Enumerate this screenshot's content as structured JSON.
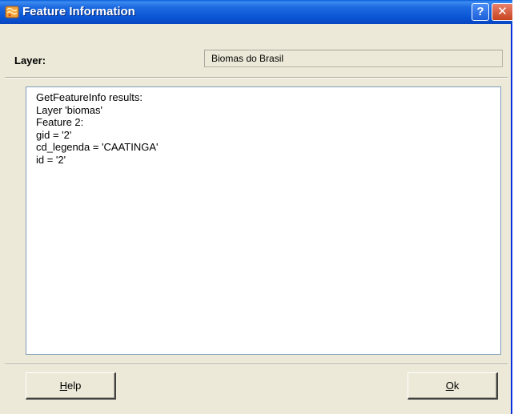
{
  "window": {
    "title": "Feature Information",
    "help_glyph": "?",
    "close_glyph": "✕"
  },
  "layer": {
    "label": "Layer:",
    "value": "Biomas do Brasil"
  },
  "results": {
    "lines": [
      "GetFeatureInfo results:",
      "Layer 'biomas'",
      "Feature 2:",
      "gid = '2'",
      "cd_legenda = 'CAATINGA'",
      "id = '2'"
    ]
  },
  "buttons": {
    "help": {
      "accel": "H",
      "rest": "elp"
    },
    "ok": {
      "accel": "O",
      "rest": "k"
    }
  },
  "colors": {
    "titlebar": "#0a56d6",
    "window_bg": "#ece9d8"
  },
  "icons": {
    "app": "app-icon",
    "help": "help-icon",
    "close": "close-icon"
  }
}
